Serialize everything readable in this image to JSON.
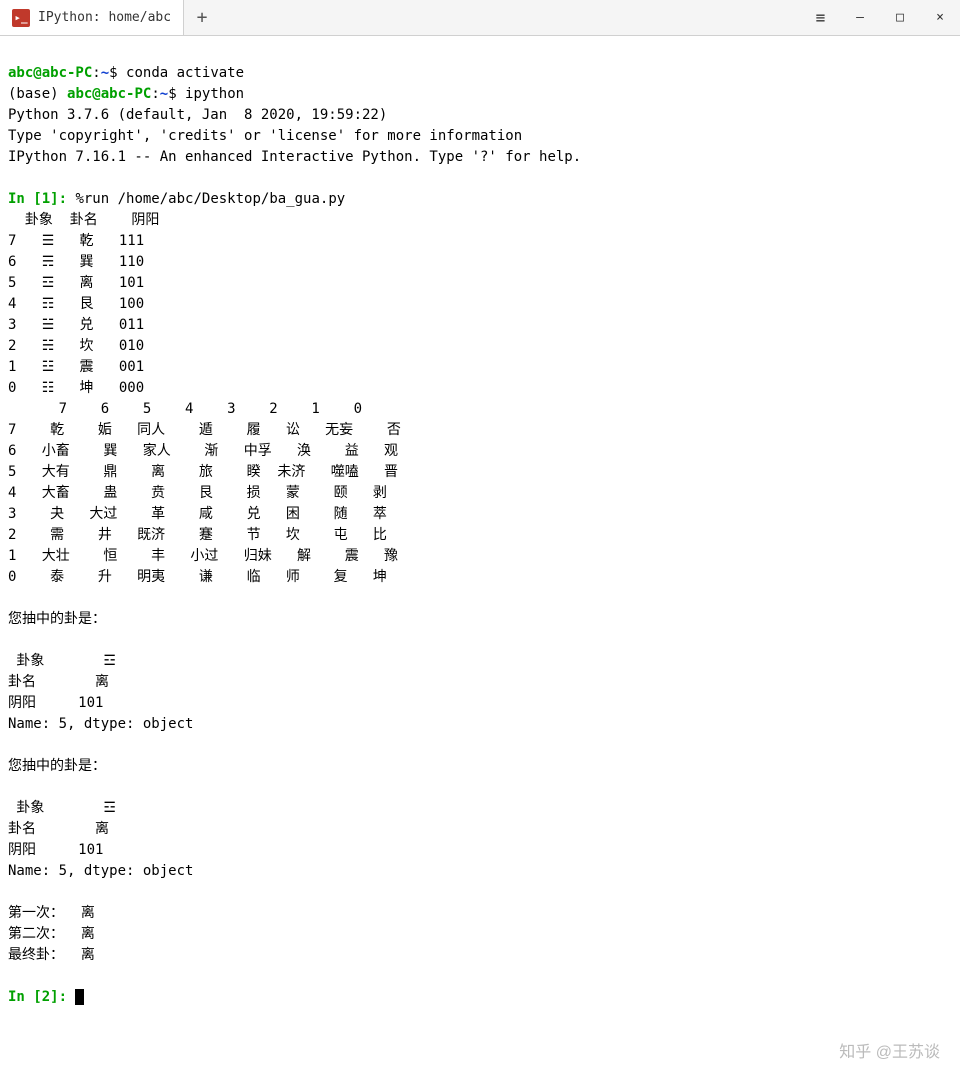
{
  "window": {
    "tab_title": "IPython: home/abc",
    "new_tab": "+",
    "menu": "≡",
    "min": "—",
    "max": "□",
    "close": "×"
  },
  "prompt1_user": "abc@abc-PC",
  "prompt1_sep": ":",
  "prompt1_path": "~",
  "prompt1_dollar": "$ ",
  "cmd1": "conda activate",
  "prompt2_prefix": "(base) ",
  "prompt2_user": "abc@abc-PC",
  "prompt2_sep": ":",
  "prompt2_path": "~",
  "prompt2_dollar": "$ ",
  "cmd2": "ipython",
  "banner1": "Python 3.7.6 (default, Jan  8 2020, 19:59:22) ",
  "banner2": "Type 'copyright', 'credits' or 'license' for more information",
  "banner3": "IPython 7.16.1 -- An enhanced Interactive Python. Type '?' for help.",
  "in1_label": "In [",
  "in1_num": "1",
  "in1_close": "]: ",
  "in1_cmd": "%run /home/abc/Desktop/ba_gua.py",
  "table1_header": "  卦象  卦名    阴阳",
  "table1_rows": [
    "7   ☰   乾   111",
    "6   ☴   巽   110",
    "5   ☲   离   101",
    "4   ☶   艮   100",
    "3   ☱   兑   011",
    "2   ☵   坎   010",
    "1   ☳   震   001",
    "0   ☷   坤   000"
  ],
  "table2_header": "      7    6    5    4    3    2    1    0",
  "table2_rows": [
    "7    乾    姤   同人    遁    履   讼   无妄    否",
    "6   小畜    巽   家人    渐   中孚   涣    益   观",
    "5   大有    鼎    离    旅    睽  未济   噬嗑   晋",
    "4   大畜    蛊    贲    艮    损   蒙    颐   剥",
    "3    夬   大过    革    咸    兑   困    随   萃",
    "2    需    井   既济    蹇    节   坎    屯   比",
    "1   大壮    恒    丰   小过   归妹   解    震   豫",
    "0    泰    升   明夷    谦    临   师    复   坤"
  ],
  "draw_label": "您抽中的卦是：",
  "result_guaxiang": " 卦象       ☲",
  "result_guaming": "卦名       离",
  "result_yinyang": "阴阳     101",
  "result_name": "Name: 5, dtype: object",
  "first": "第一次：  离",
  "second": "第二次：  离",
  "final": "最终卦：  离",
  "in2_label": "In [",
  "in2_num": "2",
  "in2_close": "]: ",
  "watermark": "知乎 @王苏谈"
}
